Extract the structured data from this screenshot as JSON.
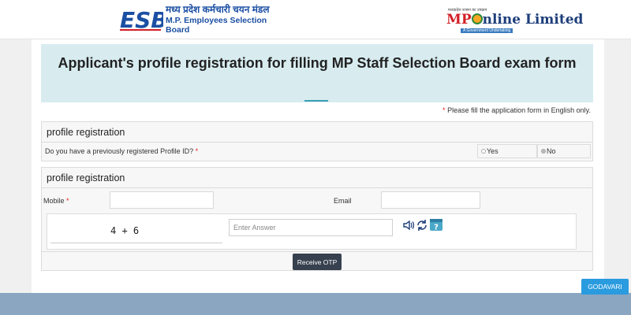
{
  "header": {
    "esb_hindi": "मध्य प्रदेश कर्मचारी चयन मंडल",
    "esb_english": "M.P. Employees Selection Board",
    "mponline_tagline": "मध्यप्रदेश शासन का उपक्रम",
    "mponline_mp": "MP",
    "mponline_rest": "nline Limited",
    "mponline_sub": "A Government Undertaking"
  },
  "title": "Applicant's profile registration for filling MP Staff Selection Board exam form",
  "note": {
    "star": "*",
    "text": " Please fill the application form in English only."
  },
  "section1": {
    "heading": "profile registration",
    "question": "Do you have a previously registered Profile ID?",
    "star": "*",
    "options": [
      "Yes",
      "No"
    ],
    "selected": "No"
  },
  "section2": {
    "heading": "profile registration",
    "mobile_label": "Mobile",
    "mobile_star": "*",
    "email_label": "Email",
    "captcha_text": "4 + 6",
    "answer_placeholder": "Enter Answer",
    "otp_button": "Receive OTP"
  },
  "floating_button": "GODAVARI",
  "icons": [
    "speaker-icon",
    "refresh-icon",
    "help-icon"
  ]
}
